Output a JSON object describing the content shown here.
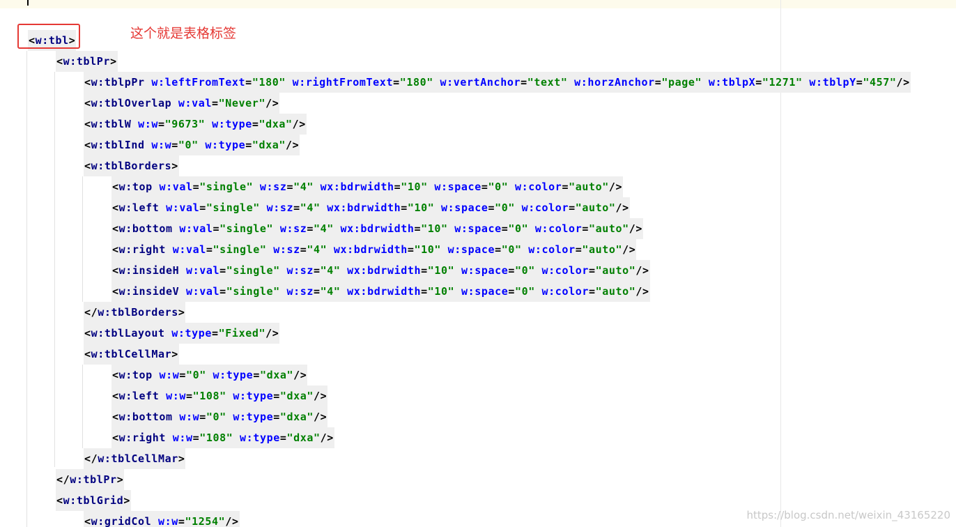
{
  "annotation": "这个就是表格标签",
  "watermark": "https://blog.csdn.net/weixin_43165220",
  "colors": {
    "tag": "#000080",
    "attribute": "#0000ff",
    "value": "#008000",
    "highlight": "#efefef",
    "annotation": "#e53935",
    "topbar": "#fdfbec"
  },
  "lines": [
    {
      "indent": 0,
      "segs": [
        [
          "p",
          "<"
        ],
        [
          "t",
          "w:tbl"
        ],
        [
          "p",
          ">"
        ]
      ]
    },
    {
      "indent": 1,
      "segs": [
        [
          "p",
          "<"
        ],
        [
          "t",
          "w:tblPr"
        ],
        [
          "p",
          ">"
        ]
      ]
    },
    {
      "indent": 2,
      "segs": [
        [
          "p",
          "<"
        ],
        [
          "t",
          "w:tblpPr"
        ],
        [
          "p",
          " "
        ],
        [
          "a",
          "w:leftFromText"
        ],
        [
          "p",
          "="
        ],
        [
          "v",
          "\"180\""
        ],
        [
          "p",
          " "
        ],
        [
          "a",
          "w:rightFromText"
        ],
        [
          "p",
          "="
        ],
        [
          "v",
          "\"180\""
        ],
        [
          "p",
          " "
        ],
        [
          "a",
          "w:vertAnchor"
        ],
        [
          "p",
          "="
        ],
        [
          "v",
          "\"text\""
        ],
        [
          "p",
          " "
        ],
        [
          "a",
          "w:horzAnchor"
        ],
        [
          "p",
          "="
        ],
        [
          "v",
          "\"page\""
        ],
        [
          "p",
          " "
        ],
        [
          "a",
          "w:tblpX"
        ],
        [
          "p",
          "="
        ],
        [
          "v",
          "\"1271\""
        ],
        [
          "p",
          " "
        ],
        [
          "a",
          "w:tblpY"
        ],
        [
          "p",
          "="
        ],
        [
          "v",
          "\"457\""
        ],
        [
          "p",
          "/>"
        ]
      ]
    },
    {
      "indent": 2,
      "segs": [
        [
          "p",
          "<"
        ],
        [
          "t",
          "w:tblOverlap"
        ],
        [
          "p",
          " "
        ],
        [
          "a",
          "w:val"
        ],
        [
          "p",
          "="
        ],
        [
          "v",
          "\"Never\""
        ],
        [
          "p",
          "/>"
        ]
      ]
    },
    {
      "indent": 2,
      "segs": [
        [
          "p",
          "<"
        ],
        [
          "t",
          "w:tblW"
        ],
        [
          "p",
          " "
        ],
        [
          "a",
          "w:w"
        ],
        [
          "p",
          "="
        ],
        [
          "v",
          "\"9673\""
        ],
        [
          "p",
          " "
        ],
        [
          "a",
          "w:type"
        ],
        [
          "p",
          "="
        ],
        [
          "v",
          "\"dxa\""
        ],
        [
          "p",
          "/>"
        ]
      ]
    },
    {
      "indent": 2,
      "segs": [
        [
          "p",
          "<"
        ],
        [
          "t",
          "w:tblInd"
        ],
        [
          "p",
          " "
        ],
        [
          "a",
          "w:w"
        ],
        [
          "p",
          "="
        ],
        [
          "v",
          "\"0\""
        ],
        [
          "p",
          " "
        ],
        [
          "a",
          "w:type"
        ],
        [
          "p",
          "="
        ],
        [
          "v",
          "\"dxa\""
        ],
        [
          "p",
          "/>"
        ]
      ]
    },
    {
      "indent": 2,
      "segs": [
        [
          "p",
          "<"
        ],
        [
          "t",
          "w:tblBorders"
        ],
        [
          "p",
          ">"
        ]
      ]
    },
    {
      "indent": 3,
      "segs": [
        [
          "p",
          "<"
        ],
        [
          "t",
          "w:top"
        ],
        [
          "p",
          " "
        ],
        [
          "a",
          "w:val"
        ],
        [
          "p",
          "="
        ],
        [
          "v",
          "\"single\""
        ],
        [
          "p",
          " "
        ],
        [
          "a",
          "w:sz"
        ],
        [
          "p",
          "="
        ],
        [
          "v",
          "\"4\""
        ],
        [
          "p",
          " "
        ],
        [
          "a",
          "wx:bdrwidth"
        ],
        [
          "p",
          "="
        ],
        [
          "v",
          "\"10\""
        ],
        [
          "p",
          " "
        ],
        [
          "a",
          "w:space"
        ],
        [
          "p",
          "="
        ],
        [
          "v",
          "\"0\""
        ],
        [
          "p",
          " "
        ],
        [
          "a",
          "w:color"
        ],
        [
          "p",
          "="
        ],
        [
          "v",
          "\"auto\""
        ],
        [
          "p",
          "/>"
        ]
      ]
    },
    {
      "indent": 3,
      "segs": [
        [
          "p",
          "<"
        ],
        [
          "t",
          "w:left"
        ],
        [
          "p",
          " "
        ],
        [
          "a",
          "w:val"
        ],
        [
          "p",
          "="
        ],
        [
          "v",
          "\"single\""
        ],
        [
          "p",
          " "
        ],
        [
          "a",
          "w:sz"
        ],
        [
          "p",
          "="
        ],
        [
          "v",
          "\"4\""
        ],
        [
          "p",
          " "
        ],
        [
          "a",
          "wx:bdrwidth"
        ],
        [
          "p",
          "="
        ],
        [
          "v",
          "\"10\""
        ],
        [
          "p",
          " "
        ],
        [
          "a",
          "w:space"
        ],
        [
          "p",
          "="
        ],
        [
          "v",
          "\"0\""
        ],
        [
          "p",
          " "
        ],
        [
          "a",
          "w:color"
        ],
        [
          "p",
          "="
        ],
        [
          "v",
          "\"auto\""
        ],
        [
          "p",
          "/>"
        ]
      ]
    },
    {
      "indent": 3,
      "segs": [
        [
          "p",
          "<"
        ],
        [
          "t",
          "w:bottom"
        ],
        [
          "p",
          " "
        ],
        [
          "a",
          "w:val"
        ],
        [
          "p",
          "="
        ],
        [
          "v",
          "\"single\""
        ],
        [
          "p",
          " "
        ],
        [
          "a",
          "w:sz"
        ],
        [
          "p",
          "="
        ],
        [
          "v",
          "\"4\""
        ],
        [
          "p",
          " "
        ],
        [
          "a",
          "wx:bdrwidth"
        ],
        [
          "p",
          "="
        ],
        [
          "v",
          "\"10\""
        ],
        [
          "p",
          " "
        ],
        [
          "a",
          "w:space"
        ],
        [
          "p",
          "="
        ],
        [
          "v",
          "\"0\""
        ],
        [
          "p",
          " "
        ],
        [
          "a",
          "w:color"
        ],
        [
          "p",
          "="
        ],
        [
          "v",
          "\"auto\""
        ],
        [
          "p",
          "/>"
        ]
      ]
    },
    {
      "indent": 3,
      "segs": [
        [
          "p",
          "<"
        ],
        [
          "t",
          "w:right"
        ],
        [
          "p",
          " "
        ],
        [
          "a",
          "w:val"
        ],
        [
          "p",
          "="
        ],
        [
          "v",
          "\"single\""
        ],
        [
          "p",
          " "
        ],
        [
          "a",
          "w:sz"
        ],
        [
          "p",
          "="
        ],
        [
          "v",
          "\"4\""
        ],
        [
          "p",
          " "
        ],
        [
          "a",
          "wx:bdrwidth"
        ],
        [
          "p",
          "="
        ],
        [
          "v",
          "\"10\""
        ],
        [
          "p",
          " "
        ],
        [
          "a",
          "w:space"
        ],
        [
          "p",
          "="
        ],
        [
          "v",
          "\"0\""
        ],
        [
          "p",
          " "
        ],
        [
          "a",
          "w:color"
        ],
        [
          "p",
          "="
        ],
        [
          "v",
          "\"auto\""
        ],
        [
          "p",
          "/>"
        ]
      ]
    },
    {
      "indent": 3,
      "segs": [
        [
          "p",
          "<"
        ],
        [
          "t",
          "w:insideH"
        ],
        [
          "p",
          " "
        ],
        [
          "a",
          "w:val"
        ],
        [
          "p",
          "="
        ],
        [
          "v",
          "\"single\""
        ],
        [
          "p",
          " "
        ],
        [
          "a",
          "w:sz"
        ],
        [
          "p",
          "="
        ],
        [
          "v",
          "\"4\""
        ],
        [
          "p",
          " "
        ],
        [
          "a",
          "wx:bdrwidth"
        ],
        [
          "p",
          "="
        ],
        [
          "v",
          "\"10\""
        ],
        [
          "p",
          " "
        ],
        [
          "a",
          "w:space"
        ],
        [
          "p",
          "="
        ],
        [
          "v",
          "\"0\""
        ],
        [
          "p",
          " "
        ],
        [
          "a",
          "w:color"
        ],
        [
          "p",
          "="
        ],
        [
          "v",
          "\"auto\""
        ],
        [
          "p",
          "/>"
        ]
      ]
    },
    {
      "indent": 3,
      "segs": [
        [
          "p",
          "<"
        ],
        [
          "t",
          "w:insideV"
        ],
        [
          "p",
          " "
        ],
        [
          "a",
          "w:val"
        ],
        [
          "p",
          "="
        ],
        [
          "v",
          "\"single\""
        ],
        [
          "p",
          " "
        ],
        [
          "a",
          "w:sz"
        ],
        [
          "p",
          "="
        ],
        [
          "v",
          "\"4\""
        ],
        [
          "p",
          " "
        ],
        [
          "a",
          "wx:bdrwidth"
        ],
        [
          "p",
          "="
        ],
        [
          "v",
          "\"10\""
        ],
        [
          "p",
          " "
        ],
        [
          "a",
          "w:space"
        ],
        [
          "p",
          "="
        ],
        [
          "v",
          "\"0\""
        ],
        [
          "p",
          " "
        ],
        [
          "a",
          "w:color"
        ],
        [
          "p",
          "="
        ],
        [
          "v",
          "\"auto\""
        ],
        [
          "p",
          "/>"
        ]
      ]
    },
    {
      "indent": 2,
      "segs": [
        [
          "p",
          "</"
        ],
        [
          "t",
          "w:tblBorders"
        ],
        [
          "p",
          ">"
        ]
      ]
    },
    {
      "indent": 2,
      "segs": [
        [
          "p",
          "<"
        ],
        [
          "t",
          "w:tblLayout"
        ],
        [
          "p",
          " "
        ],
        [
          "a",
          "w:type"
        ],
        [
          "p",
          "="
        ],
        [
          "v",
          "\"Fixed\""
        ],
        [
          "p",
          "/>"
        ]
      ]
    },
    {
      "indent": 2,
      "segs": [
        [
          "p",
          "<"
        ],
        [
          "t",
          "w:tblCellMar"
        ],
        [
          "p",
          ">"
        ]
      ]
    },
    {
      "indent": 3,
      "segs": [
        [
          "p",
          "<"
        ],
        [
          "t",
          "w:top"
        ],
        [
          "p",
          " "
        ],
        [
          "a",
          "w:w"
        ],
        [
          "p",
          "="
        ],
        [
          "v",
          "\"0\""
        ],
        [
          "p",
          " "
        ],
        [
          "a",
          "w:type"
        ],
        [
          "p",
          "="
        ],
        [
          "v",
          "\"dxa\""
        ],
        [
          "p",
          "/>"
        ]
      ]
    },
    {
      "indent": 3,
      "segs": [
        [
          "p",
          "<"
        ],
        [
          "t",
          "w:left"
        ],
        [
          "p",
          " "
        ],
        [
          "a",
          "w:w"
        ],
        [
          "p",
          "="
        ],
        [
          "v",
          "\"108\""
        ],
        [
          "p",
          " "
        ],
        [
          "a",
          "w:type"
        ],
        [
          "p",
          "="
        ],
        [
          "v",
          "\"dxa\""
        ],
        [
          "p",
          "/>"
        ]
      ]
    },
    {
      "indent": 3,
      "segs": [
        [
          "p",
          "<"
        ],
        [
          "t",
          "w:bottom"
        ],
        [
          "p",
          " "
        ],
        [
          "a",
          "w:w"
        ],
        [
          "p",
          "="
        ],
        [
          "v",
          "\"0\""
        ],
        [
          "p",
          " "
        ],
        [
          "a",
          "w:type"
        ],
        [
          "p",
          "="
        ],
        [
          "v",
          "\"dxa\""
        ],
        [
          "p",
          "/>"
        ]
      ]
    },
    {
      "indent": 3,
      "segs": [
        [
          "p",
          "<"
        ],
        [
          "t",
          "w:right"
        ],
        [
          "p",
          " "
        ],
        [
          "a",
          "w:w"
        ],
        [
          "p",
          "="
        ],
        [
          "v",
          "\"108\""
        ],
        [
          "p",
          " "
        ],
        [
          "a",
          "w:type"
        ],
        [
          "p",
          "="
        ],
        [
          "v",
          "\"dxa\""
        ],
        [
          "p",
          "/>"
        ]
      ]
    },
    {
      "indent": 2,
      "segs": [
        [
          "p",
          "</"
        ],
        [
          "t",
          "w:tblCellMar"
        ],
        [
          "p",
          ">"
        ]
      ]
    },
    {
      "indent": 1,
      "segs": [
        [
          "p",
          "</"
        ],
        [
          "t",
          "w:tblPr"
        ],
        [
          "p",
          ">"
        ]
      ]
    },
    {
      "indent": 1,
      "segs": [
        [
          "p",
          "<"
        ],
        [
          "t",
          "w:tblGrid"
        ],
        [
          "p",
          ">"
        ]
      ]
    },
    {
      "indent": 2,
      "segs": [
        [
          "p",
          "<"
        ],
        [
          "t",
          "w:gridCol"
        ],
        [
          "p",
          " "
        ],
        [
          "a",
          "w:w"
        ],
        [
          "p",
          "="
        ],
        [
          "v",
          "\"1254\""
        ],
        [
          "p",
          "/>"
        ]
      ]
    }
  ]
}
